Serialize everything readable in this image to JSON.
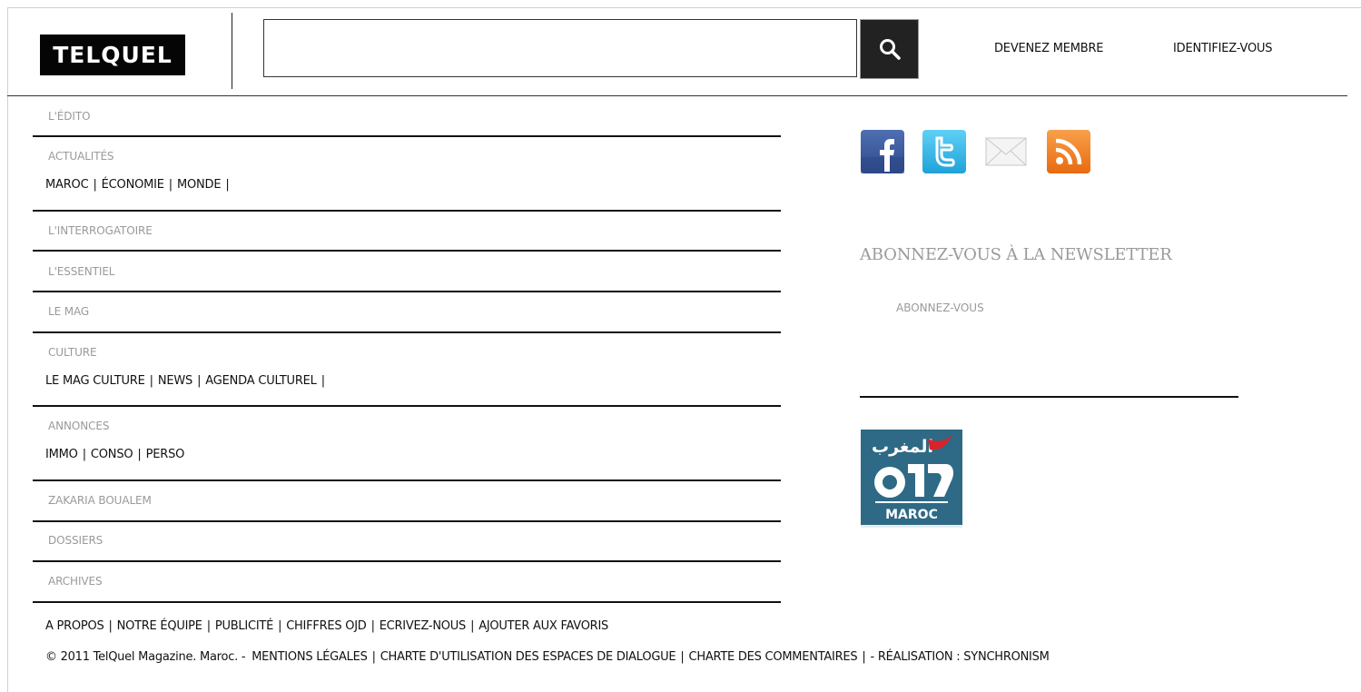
{
  "header": {
    "logo_text": "TELQUEL",
    "search": {
      "value": "",
      "placeholder": ""
    },
    "links": {
      "member": "DEVENEZ MEMBRE",
      "login": "IDENTIFIEZ-VOUS"
    }
  },
  "nav": {
    "edito": "L'ÉDITO",
    "actualites": {
      "title": "ACTUALITÉS",
      "subs": [
        "MAROC",
        "ÉCONOMIE",
        "MONDE"
      ]
    },
    "interrogatoire": "L'INTERROGATOIRE",
    "essentiel": "L'ESSENTIEL",
    "mag": "LE MAG",
    "culture": {
      "title": "CULTURE",
      "subs": [
        "LE MAG CULTURE",
        "NEWS",
        "AGENDA CULTUREL"
      ]
    },
    "annonces": {
      "title": "ANNONCES",
      "subs": [
        "IMMO",
        "CONSO",
        "PERSO"
      ]
    },
    "zakaria": "ZAKARIA BOUALEM",
    "dossiers": "DOSSIERS",
    "archives": "ARCHIVES",
    "separator": "|"
  },
  "sidebar": {
    "social_icons": [
      "facebook-icon",
      "twitter-icon",
      "email-icon",
      "rss-icon"
    ],
    "newsletter_title": "ABONNEZ-VOUS À LA NEWSLETTER",
    "newsletter_link": "ABONNEZ-VOUS",
    "badge_arabic": "المغرب",
    "badge_word": "MAROC"
  },
  "footer": {
    "links": [
      "A PROPOS",
      "NOTRE ÉQUIPE",
      "PUBLICITÉ",
      "CHIFFRES OJD",
      "ECRIVEZ-NOUS",
      "AJOUTER AUX FAVORIS"
    ],
    "copyright": "© 2011 TelQuel Magazine. Maroc. -",
    "legal": [
      "MENTIONS LÉGALES",
      "CHARTE D'UTILISATION DES ESPACES DE DIALOGUE",
      "CHARTE DES COMMENTAIRES"
    ],
    "realisation": "- RÉALISATION : SYNCHRONISM"
  },
  "colors": {
    "muted": "#9a9a9a",
    "facebook": "#3b5998",
    "twitter": "#2fb4e6",
    "rss": "#f0791f",
    "badge_bg": "#2e6a85",
    "badge_accent": "#d8232a"
  }
}
